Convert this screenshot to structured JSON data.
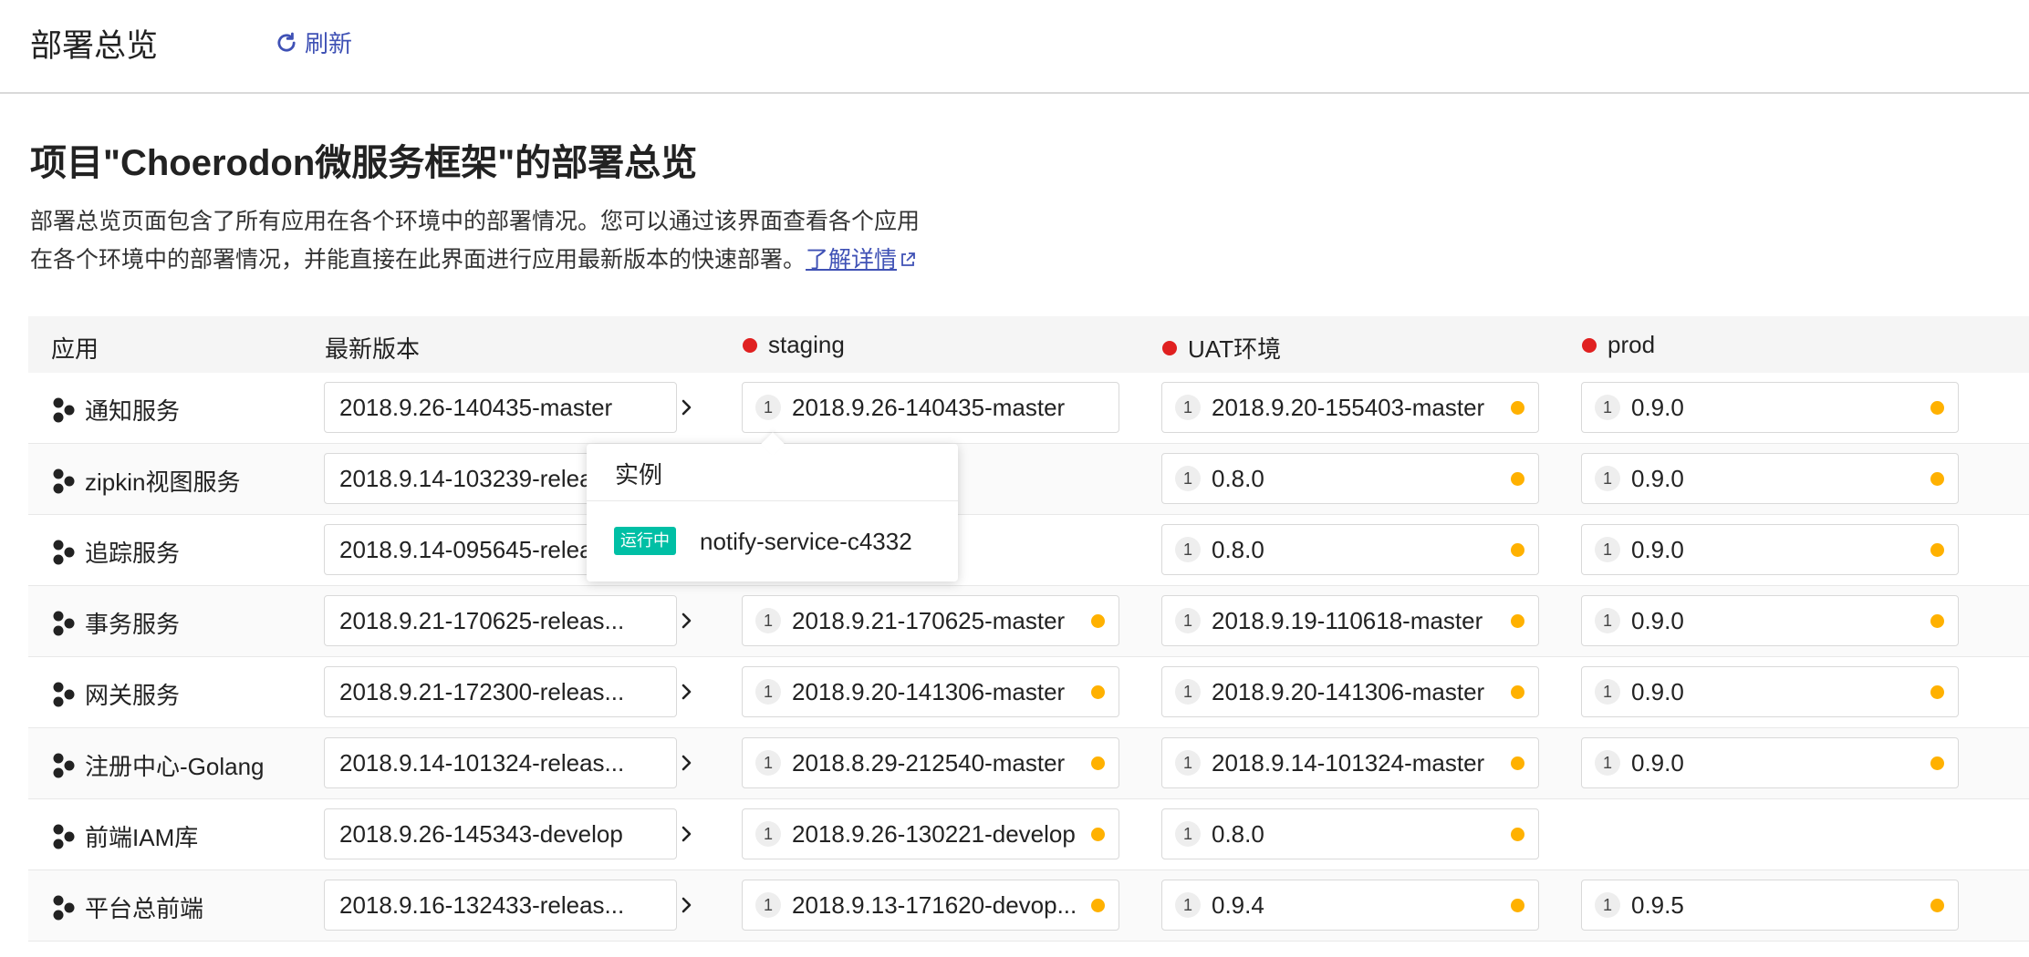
{
  "header": {
    "title": "部署总览",
    "refresh_label": "刷新"
  },
  "intro": {
    "heading": "项目\"Choerodon微服务框架\"的部署总览",
    "desc_line1": "部署总览页面包含了所有应用在各个环境中的部署情况。您可以通过该界面查看各个应用",
    "desc_line2": "在各个环境中的部署情况，并能直接在此界面进行应用最新版本的快速部署。",
    "learn_more": "了解详情"
  },
  "columns": {
    "app": "应用",
    "latest": "最新版本",
    "env1": "staging",
    "env2": "UAT环境",
    "env3": "prod"
  },
  "colors": {
    "accent": "#3f51b5",
    "env_dot": "#e02020",
    "status_dot": "#ffb100",
    "running_badge": "#00bfa5"
  },
  "rows": [
    {
      "app": "通知服务",
      "latest": "2018.9.26-140435-master",
      "env1": {
        "count": "1",
        "version": "2018.9.26-140435-master",
        "status": false
      },
      "env2": {
        "count": "1",
        "version": "2018.9.20-155403-master",
        "status": true
      },
      "env3": {
        "count": "1",
        "version": "0.9.0",
        "status": true
      }
    },
    {
      "app": "zipkin视图服务",
      "latest": "2018.9.14-103239-release",
      "env1": null,
      "env2": {
        "count": "1",
        "version": "0.8.0",
        "status": true
      },
      "env3": {
        "count": "1",
        "version": "0.9.0",
        "status": true
      }
    },
    {
      "app": "追踪服务",
      "latest": "2018.9.14-095645-release",
      "env1": null,
      "env2": {
        "count": "1",
        "version": "0.8.0",
        "status": true
      },
      "env3": {
        "count": "1",
        "version": "0.9.0",
        "status": true
      }
    },
    {
      "app": "事务服务",
      "latest": "2018.9.21-170625-releas...",
      "env1": {
        "count": "1",
        "version": "2018.9.21-170625-master",
        "status": true
      },
      "env2": {
        "count": "1",
        "version": "2018.9.19-110618-master",
        "status": true
      },
      "env3": {
        "count": "1",
        "version": "0.9.0",
        "status": true
      }
    },
    {
      "app": "网关服务",
      "latest": "2018.9.21-172300-releas...",
      "env1": {
        "count": "1",
        "version": "2018.9.20-141306-master",
        "status": true
      },
      "env2": {
        "count": "1",
        "version": "2018.9.20-141306-master",
        "status": true
      },
      "env3": {
        "count": "1",
        "version": "0.9.0",
        "status": true
      }
    },
    {
      "app": "注册中心-Golang",
      "latest": "2018.9.14-101324-releas...",
      "env1": {
        "count": "1",
        "version": "2018.8.29-212540-master",
        "status": true
      },
      "env2": {
        "count": "1",
        "version": "2018.9.14-101324-master",
        "status": true
      },
      "env3": {
        "count": "1",
        "version": "0.9.0",
        "status": true
      }
    },
    {
      "app": "前端IAM库",
      "latest": "2018.9.26-145343-develop",
      "env1": {
        "count": "1",
        "version": "2018.9.26-130221-develop",
        "status": true
      },
      "env2": {
        "count": "1",
        "version": "0.8.0",
        "status": true
      },
      "env3": null
    },
    {
      "app": "平台总前端",
      "latest": "2018.9.16-132433-releas...",
      "env1": {
        "count": "1",
        "version": "2018.9.13-171620-devop...",
        "status": true
      },
      "env2": {
        "count": "1",
        "version": "0.9.4",
        "status": true
      },
      "env3": {
        "count": "1",
        "version": "0.9.5",
        "status": true
      }
    }
  ],
  "popover": {
    "title": "实例",
    "status": "运行中",
    "instance": "notify-service-c4332"
  }
}
